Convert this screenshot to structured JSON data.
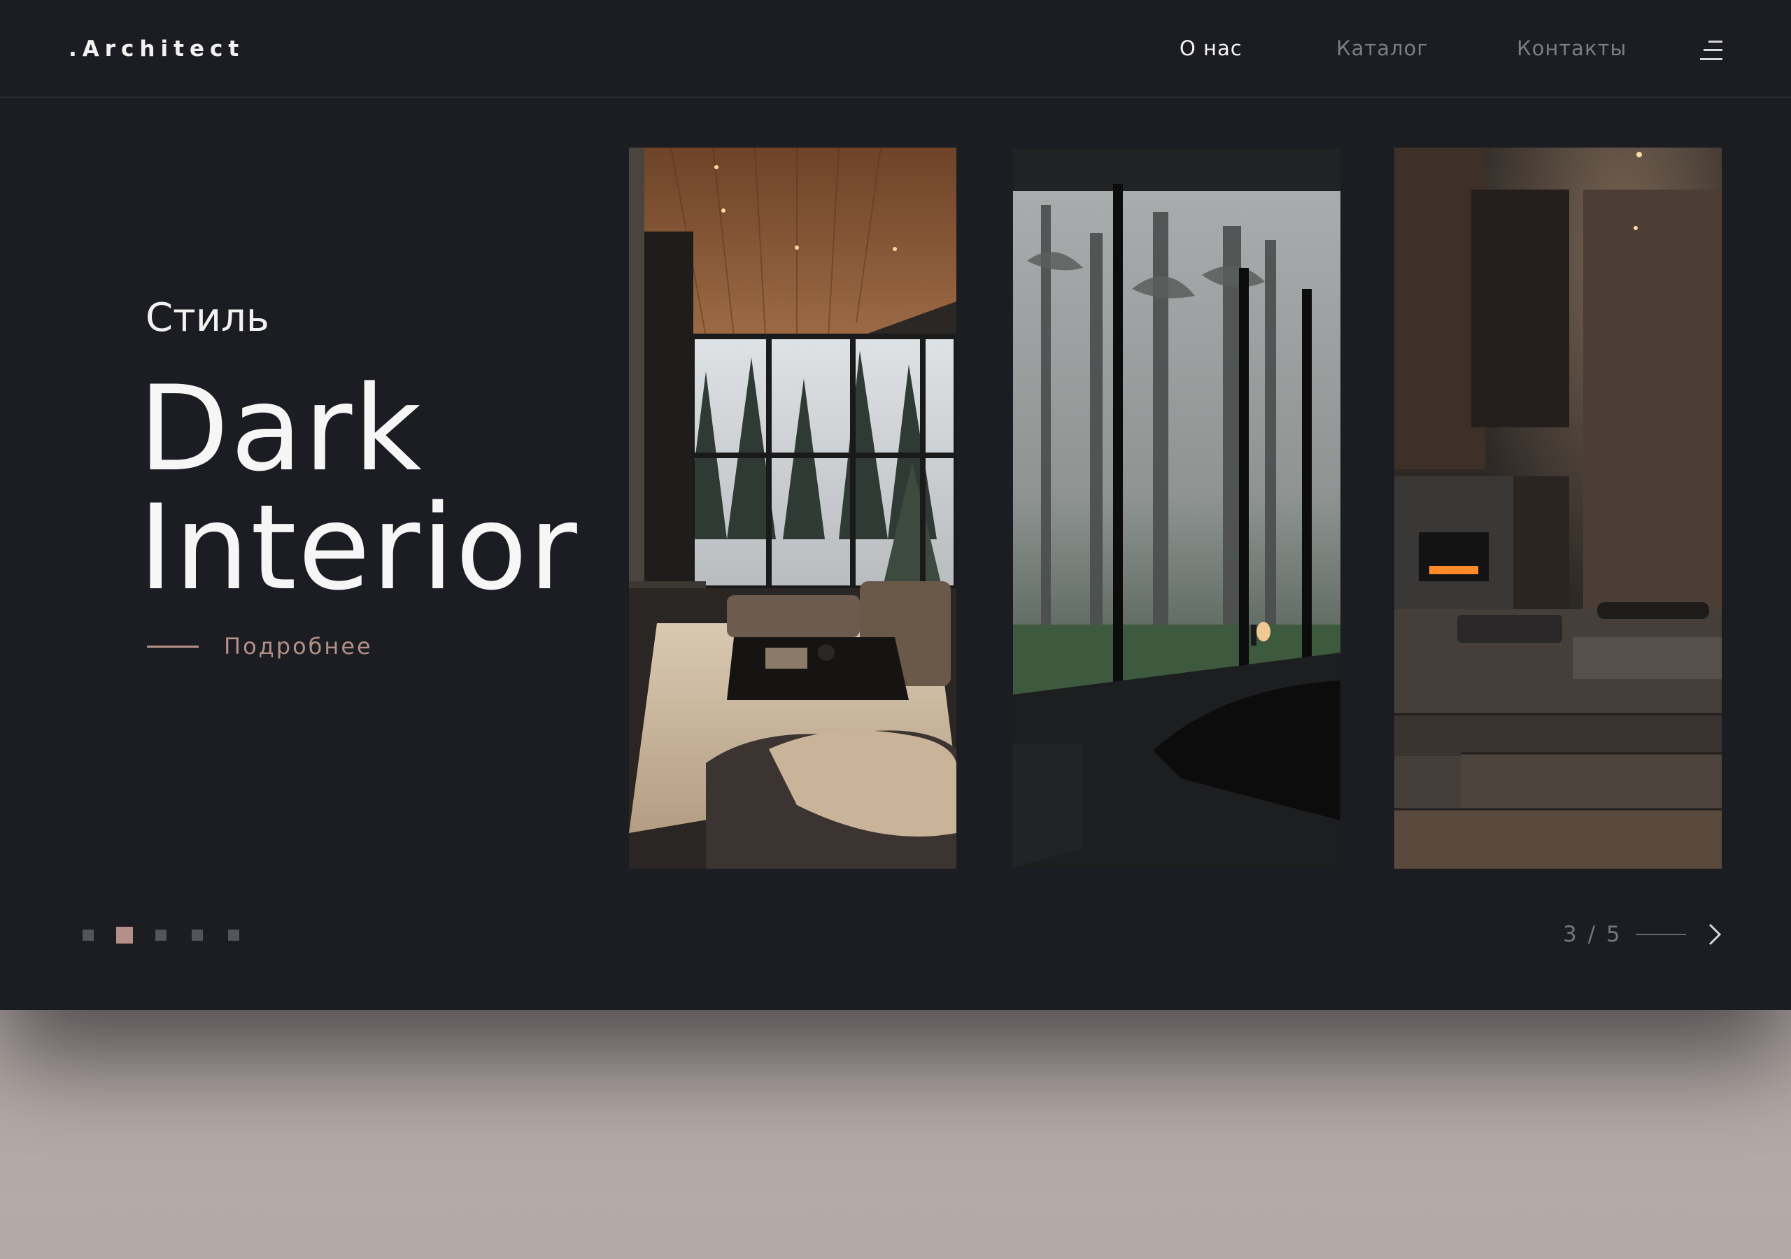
{
  "header": {
    "logo": ".Architect",
    "nav": [
      {
        "label": "О нас",
        "active": true
      },
      {
        "label": "Каталог",
        "active": false
      },
      {
        "label": "Контакты",
        "active": false
      }
    ],
    "menu_icon": "hamburger-menu-icon"
  },
  "hero": {
    "subtitle": "Стиль",
    "title_line1": "Dark",
    "title_line2": "Interior",
    "more_label": "Подробнее"
  },
  "gallery": {
    "cards": [
      {
        "scene": "living-room-with-forest-view"
      },
      {
        "scene": "bedroom-with-misty-forest"
      },
      {
        "scene": "dark-atrium-with-fireplace"
      }
    ]
  },
  "pagination": {
    "dots_total": 5,
    "active_dot": 2,
    "counter": "3 / 5",
    "next_icon": "chevron-right-icon"
  },
  "colors": {
    "background": "#1c1d22",
    "accent": "#b39088",
    "text": "#f2f2f2",
    "muted": "#7c7d83",
    "outer_background": "#b8aeaa"
  }
}
